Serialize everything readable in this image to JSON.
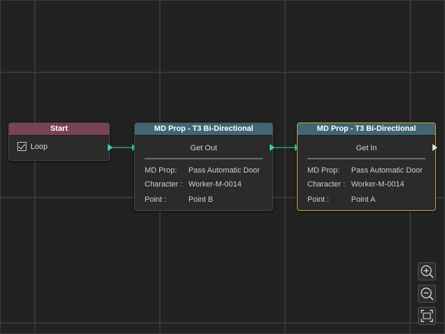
{
  "nodes": {
    "start": {
      "title": "Start",
      "loop_label": "Loop",
      "loop_checked": true
    },
    "node1": {
      "title": "MD Prop - T3 Bi-Directional",
      "action": "Get Out",
      "fields": [
        {
          "key": "MD Prop:",
          "value": "Pass Automatic Door"
        },
        {
          "key": "Character :",
          "value": "Worker-M-0014"
        },
        {
          "key": "Point :",
          "value": "Point B"
        }
      ]
    },
    "node2": {
      "title": "MD Prop - T3 Bi-Directional",
      "action": "Get In",
      "fields": [
        {
          "key": "MD Prop:",
          "value": "Pass Automatic Door"
        },
        {
          "key": "Character :",
          "value": "Worker-M-0014"
        },
        {
          "key": "Point :",
          "value": "Point A"
        }
      ],
      "selected": true
    }
  },
  "colors": {
    "start_header": "#7a4256",
    "md_header": "#3f6672",
    "connector": "#2fd6c2",
    "selection": "#c9a52a",
    "background": "#222222"
  },
  "controls": {
    "zoom_in_icon": "zoom-in-icon",
    "zoom_out_icon": "zoom-out-icon",
    "fit_view_icon": "fit-view-icon"
  }
}
